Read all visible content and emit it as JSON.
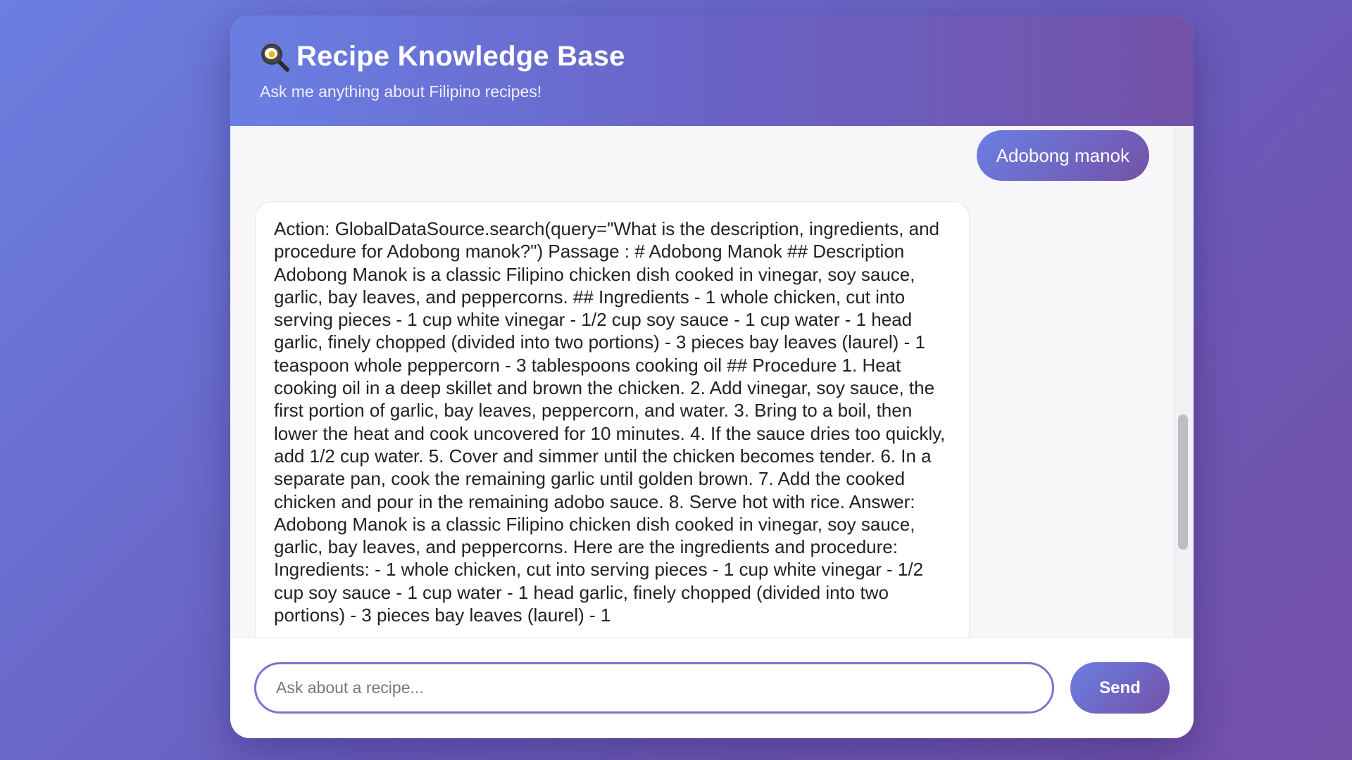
{
  "header": {
    "icon": "frying-pan-egg-icon",
    "title": "Recipe Knowledge Base",
    "subtitle": "Ask me anything about Filipino recipes!"
  },
  "messages": [
    {
      "role": "user",
      "text": "Adobong manok"
    },
    {
      "role": "assistant",
      "text": "Action: GlobalDataSource.search(query=\"What is the description, ingredients, and procedure for Adobong manok?\") Passage : # Adobong Manok ## Description Adobong Manok is a classic Filipino chicken dish cooked in vinegar, soy sauce, garlic, bay leaves, and peppercorns. ## Ingredients - 1 whole chicken, cut into serving pieces - 1 cup white vinegar - 1/2 cup soy sauce - 1 cup water - 1 head garlic, finely chopped (divided into two portions) - 3 pieces bay leaves (laurel) - 1 teaspoon whole peppercorn - 3 tablespoons cooking oil ## Procedure 1. Heat cooking oil in a deep skillet and brown the chicken. 2. Add vinegar, soy sauce, the first portion of garlic, bay leaves, peppercorn, and water. 3. Bring to a boil, then lower the heat and cook uncovered for 10 minutes. 4. If the sauce dries too quickly, add 1/2 cup water. 5. Cover and simmer until the chicken becomes tender. 6. In a separate pan, cook the remaining garlic until golden brown. 7. Add the cooked chicken and pour in the remaining adobo sauce. 8. Serve hot with rice. Answer: Adobong Manok is a classic Filipino chicken dish cooked in vinegar, soy sauce, garlic, bay leaves, and peppercorns. Here are the ingredients and procedure: Ingredients: - 1 whole chicken, cut into serving pieces - 1 cup white vinegar - 1/2 cup soy sauce - 1 cup water - 1 head garlic, finely chopped (divided into two portions) - 3 pieces bay leaves (laurel) - 1"
    }
  ],
  "input": {
    "placeholder": "Ask about a recipe...",
    "value": ""
  },
  "send_button": {
    "label": "Send"
  },
  "colors": {
    "accent_start": "#6a7fe3",
    "accent_end": "#7452a8",
    "input_border": "#7a72d4"
  }
}
